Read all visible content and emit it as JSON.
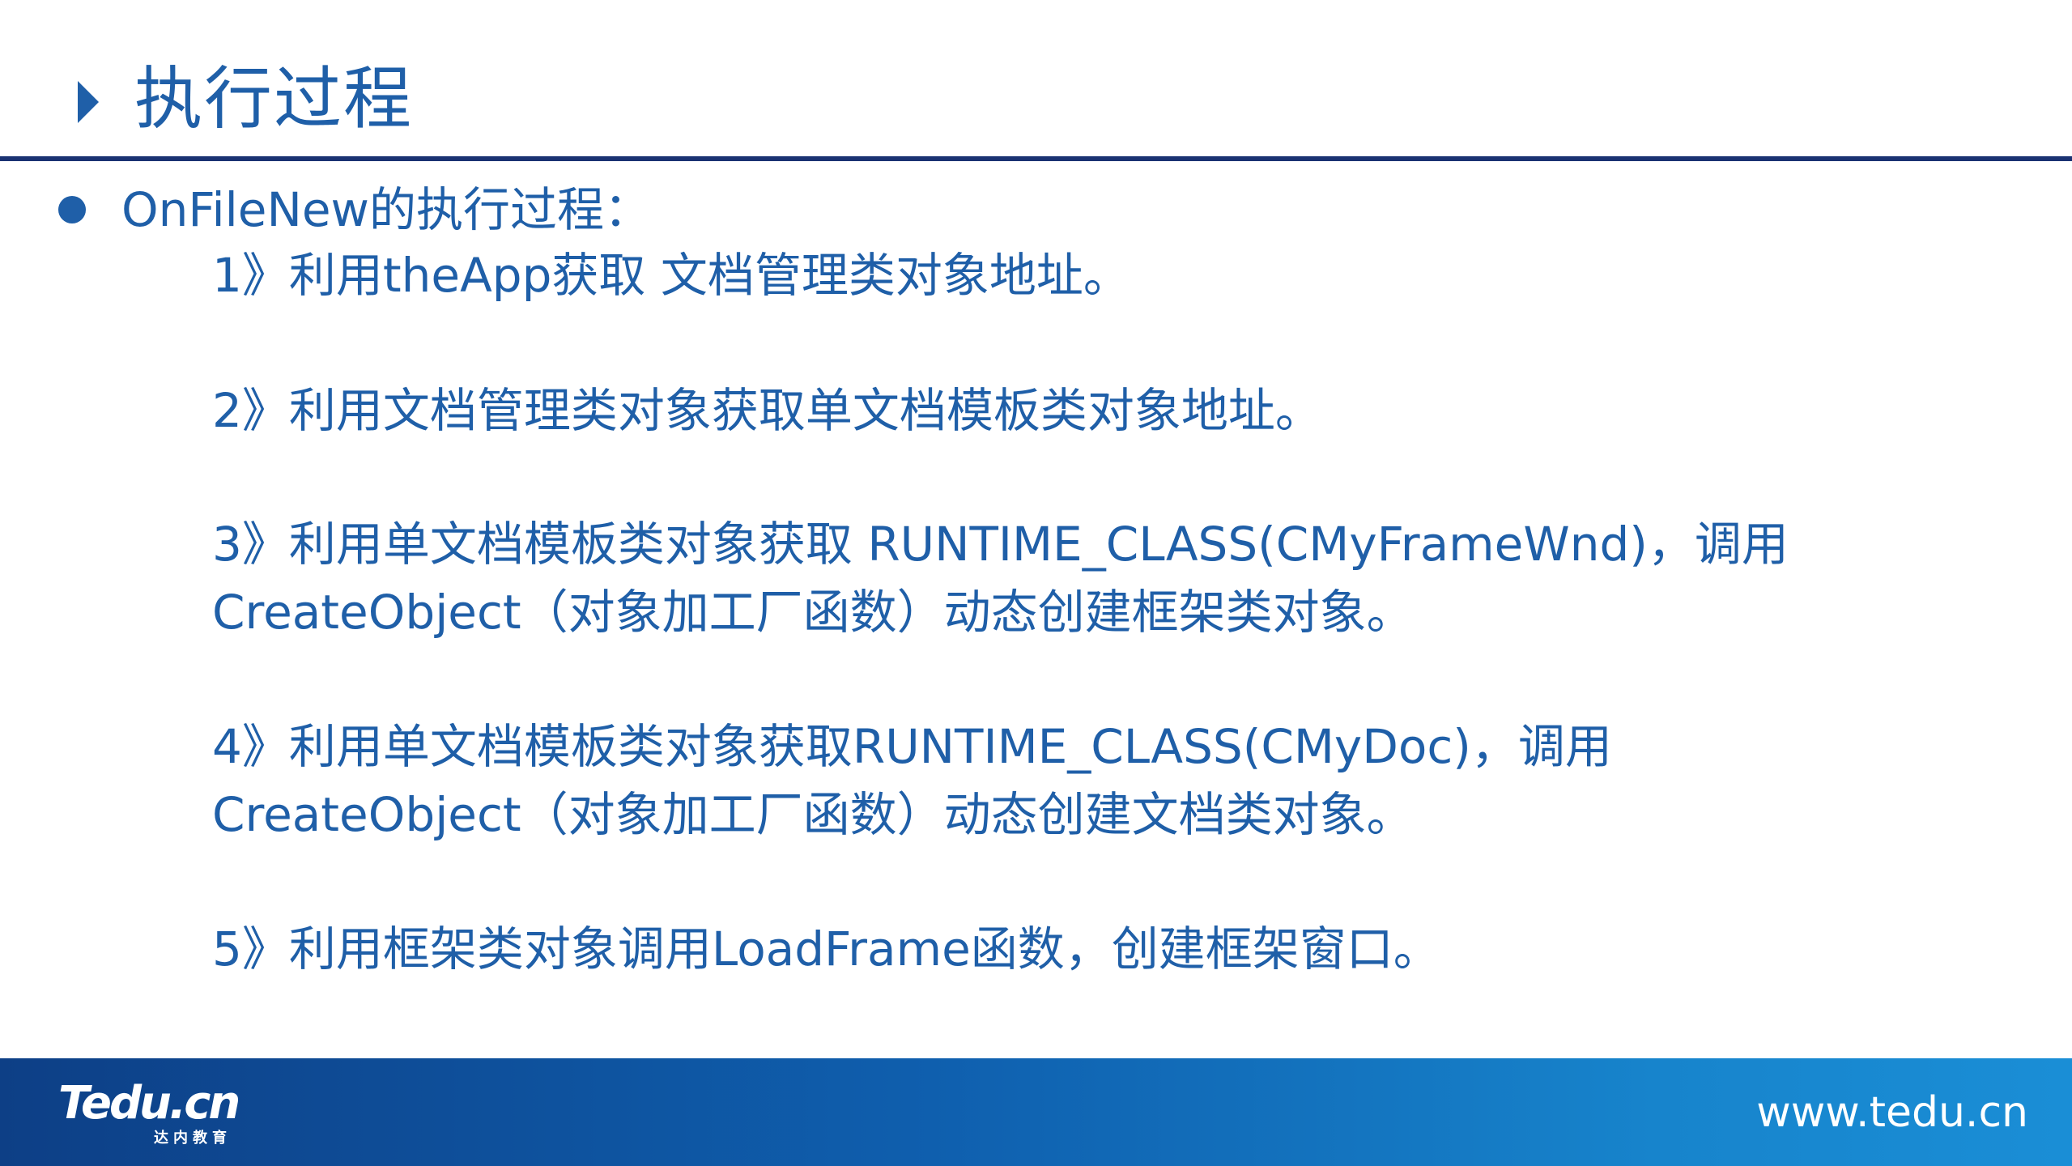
{
  "title": "执行过程",
  "bullet": "OnFileNew的执行过程：",
  "steps": [
    {
      "lines": [
        "1》利用theApp获取 文档管理类对象地址。"
      ]
    },
    {
      "lines": [
        "2》利用文档管理类对象获取单文档模板类对象地址。"
      ]
    },
    {
      "lines": [
        "3》利用单文档模板类对象获取 RUNTIME_CLASS(CMyFrameWnd)，调用",
        "CreateObject（对象加工厂函数）动态创建框架类对象。"
      ]
    },
    {
      "lines": [
        "4》利用单文档模板类对象获取RUNTIME_CLASS(CMyDoc)，调用",
        "CreateObject（对象加工厂函数）动态创建文档类对象。"
      ]
    },
    {
      "lines": [
        "5》利用框架类对象调用LoadFrame函数，创建框架窗口。"
      ]
    }
  ],
  "footer": {
    "logo_text": "Tedu.cn",
    "logo_subtitle": "达内教育",
    "url": "www.tedu.cn"
  },
  "colors": {
    "text_blue": "#1f5fa8",
    "rule_navy": "#1a3272",
    "footer_start": "#0d3f86",
    "footer_end": "#1a8ed6"
  }
}
